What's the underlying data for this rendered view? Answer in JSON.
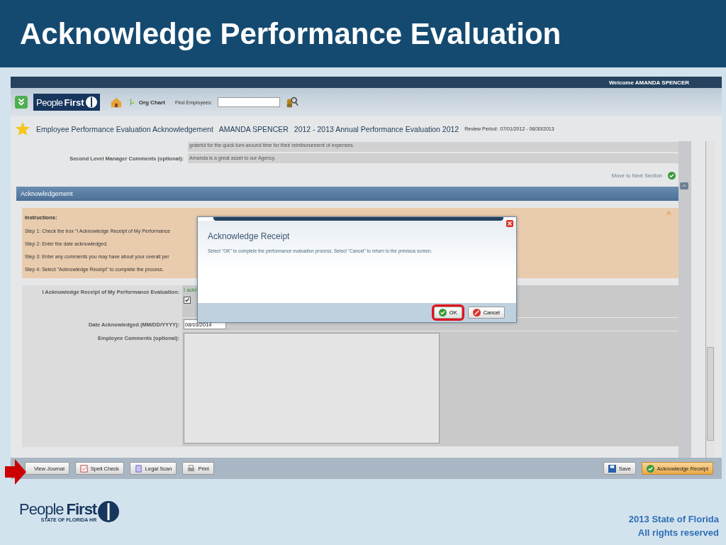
{
  "slide": {
    "title": "Acknowledge Performance Evaluation",
    "logo": {
      "word1": "People",
      "word2": "First",
      "tagline": "STATE OF FLORIDA HR"
    },
    "footer_lines": [
      "2013 State of Florida",
      "All rights reserved"
    ]
  },
  "app": {
    "welcome": "Welcome AMANDA SPENCER",
    "logo": {
      "word1": "People",
      "word2": "First"
    },
    "toolbar": {
      "org_chart": "Org Chart",
      "find_label": "Find Employees:"
    },
    "page_title": {
      "section": "Employee Performance Evaluation Acknowledgement",
      "employee": "AMANDA SPENCER",
      "evaluation": "2012 - 2013 Annual Performance Evaluation 2012",
      "review_label": "Review Period:",
      "review_dates": "07/01/2012 - 06/30/2013"
    },
    "prior": {
      "partial_text": "grateful for the quick turn-around time for their reimbursement of expenses.",
      "label": "Second Level Manager Comments (optional):",
      "value": "Amanda is a great asset to our Agency."
    },
    "move_next": "Move to Next Section",
    "section_title": "Acknowledgement",
    "instructions": {
      "heading": "Instructions:",
      "steps": [
        "Step 1: Check the box \"I Acknowledge Receipt of My Performance",
        "Step 2: Enter the date acknowledged.",
        "Step 3: Enter any comments you may have about your overall per",
        "Step 4: Select \"Acknowledge Receipt\" to complete the process."
      ]
    },
    "form": {
      "ack_label": "I Acknowledge Receipt of My Performance Evaluation:",
      "ack_text": "I ackn",
      "ack_checked": true,
      "date_label": "Date Acknowledged (MM/DD/YYYY):",
      "date_value": "08/03/2014",
      "comments_label": "Employee Comments (optional):"
    },
    "buttons_left": [
      {
        "label": "View Journal",
        "kind": "journal"
      },
      {
        "label": "Spell Check",
        "kind": "spell"
      },
      {
        "label": "Legal Scan",
        "kind": "legal"
      },
      {
        "label": "Print",
        "kind": "print"
      }
    ],
    "buttons_right": [
      {
        "label": "Save",
        "kind": "save"
      },
      {
        "label": "Acknowledge Receipt",
        "kind": "primary"
      }
    ],
    "dialog": {
      "title": "Acknowledge Receipt",
      "message": "Select \"OK\" to complete the performance evaluation process. Select \"Cancel\" to return to the previous screen.",
      "buttons": [
        {
          "label": "OK",
          "kind": "ok",
          "highlighted": true
        },
        {
          "label": "Cancel",
          "kind": "cancel",
          "highlighted": false
        }
      ]
    }
  }
}
